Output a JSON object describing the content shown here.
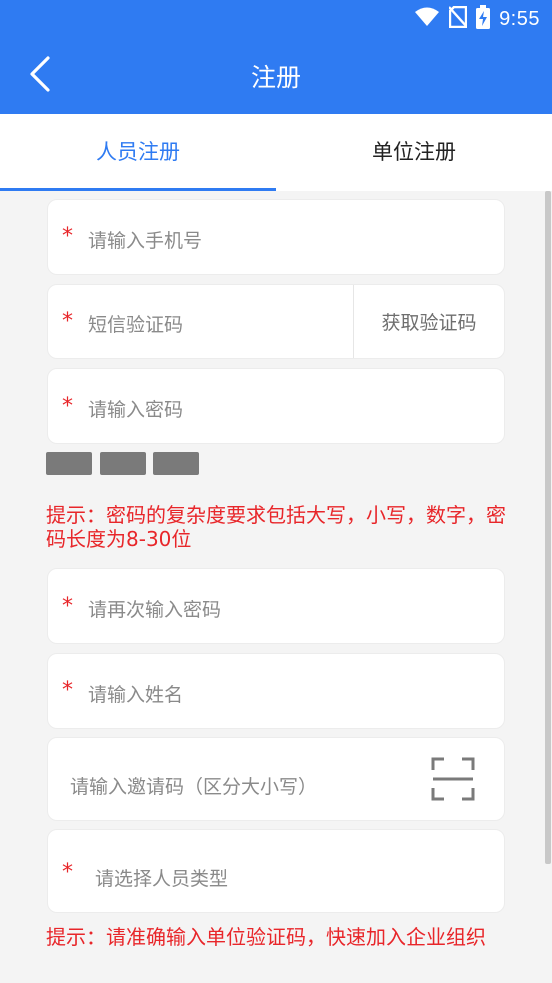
{
  "status_bar": {
    "time": "9:55",
    "icons": [
      "wifi-icon",
      "no-sim-icon",
      "battery-charging-icon"
    ]
  },
  "app_bar": {
    "title": "注册",
    "back_icon": "chevron-left-icon"
  },
  "tabs": [
    {
      "label": "人员注册",
      "active": true
    },
    {
      "label": "单位注册",
      "active": false
    }
  ],
  "form": {
    "phone": {
      "required_mark": "*",
      "placeholder": "请输入手机号"
    },
    "sms_code": {
      "required_mark": "*",
      "placeholder": "短信验证码",
      "button_label": "获取验证码"
    },
    "password": {
      "required_mark": "*",
      "placeholder": "请输入密码"
    },
    "password_strength_segments": 3,
    "password_hint": "提示：密码的复杂度要求包括大写，小写，数字，密码长度为8-30位",
    "confirm_password": {
      "required_mark": "*",
      "placeholder": "请再次输入密码"
    },
    "name": {
      "required_mark": "*",
      "placeholder": "请输入姓名"
    },
    "invite_code": {
      "placeholder": "请输入邀请码（区分大小写）",
      "scan_icon": "scan-icon"
    },
    "person_type": {
      "required_mark": "*",
      "placeholder": "请选择人员类型"
    },
    "unit_hint": "提示：请准确输入单位验证码，快速加入企业组织"
  },
  "colors": {
    "primary": "#2f7bf2",
    "required": "#e8262a",
    "background": "#f4f4f4"
  }
}
